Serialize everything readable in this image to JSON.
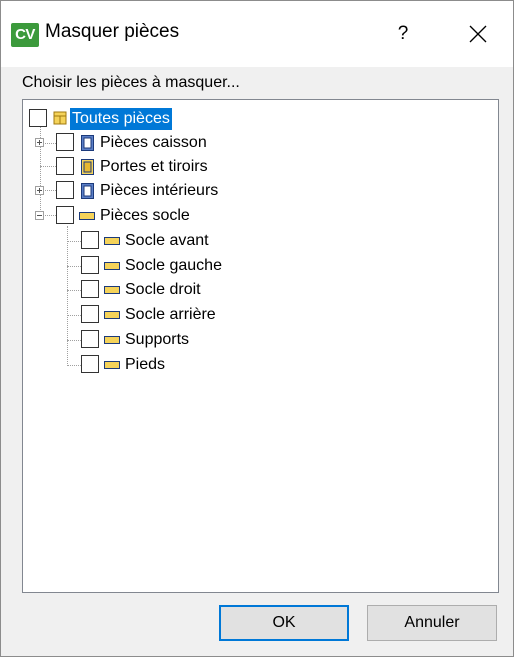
{
  "dialog": {
    "icon_text": "CV",
    "title": "Masquer pièces",
    "help": "?",
    "prompt": "Choisir les pièces à masquer...",
    "ok_label": "OK",
    "cancel_label": "Annuler"
  },
  "tree": {
    "root": {
      "label": "Toutes pièces",
      "selected": true,
      "checked": false
    },
    "items": [
      {
        "label": "Pièces caisson",
        "expandable": true,
        "expanded": false,
        "checked": false,
        "icon": "cabinet-icon"
      },
      {
        "label": "Portes et tiroirs",
        "expandable": false,
        "checked": false,
        "icon": "door-icon"
      },
      {
        "label": "Pièces intérieurs",
        "expandable": true,
        "expanded": false,
        "checked": false,
        "icon": "cabinet-icon"
      },
      {
        "label": "Pièces socle",
        "expandable": true,
        "expanded": true,
        "checked": false,
        "icon": "plinth-icon",
        "children": [
          {
            "label": "Socle avant",
            "checked": false,
            "icon": "plinth-icon"
          },
          {
            "label": "Socle gauche",
            "checked": false,
            "icon": "plinth-icon"
          },
          {
            "label": "Socle droit",
            "checked": false,
            "icon": "plinth-icon"
          },
          {
            "label": "Socle arrière",
            "checked": false,
            "icon": "plinth-icon"
          },
          {
            "label": "Supports",
            "checked": false,
            "icon": "plinth-icon"
          },
          {
            "label": "Pieds",
            "checked": false,
            "icon": "plinth-icon"
          }
        ]
      }
    ]
  },
  "colors": {
    "selection": "#0078d7",
    "app_icon": "#3c9a3c",
    "plinth_fill": "#f5d35a",
    "cabinet_fill": "#5b7fc7"
  }
}
